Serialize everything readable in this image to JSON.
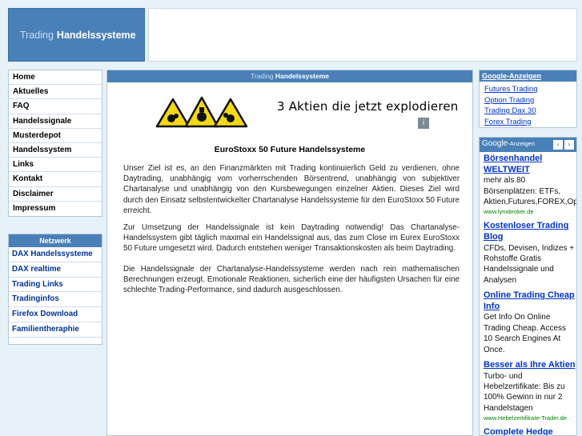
{
  "header": {
    "logo_light": "Trading",
    "logo_bold": "Handelssysteme"
  },
  "nav": [
    "Home",
    "Aktuelles",
    "FAQ",
    "Handelssignale",
    "Musterdepot",
    "Handelssystem",
    "Links",
    "Kontakt",
    "Disclaimer",
    "Impressum"
  ],
  "netzwerk": {
    "title": "Netzwerk",
    "links": [
      "DAX Handelssysteme",
      "DAX realtime",
      "Trading Links",
      "Tradinginfos",
      "Firefox Download",
      "Familientheraphie"
    ]
  },
  "main": {
    "header_light": "Trading",
    "header_bold": "Handelssysteme",
    "banner_text": "3 Aktien die jetzt explodieren",
    "headline": "EuroStoxx 50 Future Handelssysteme",
    "paragraphs": [
      "Unser Ziel ist es, an den Finanzmärkten mit Trading kontinuierlich Geld zu verdienen, ohne Daytrading, unabhängig vom vorherrschenden Börsentrend, unabhängig von subjektiver Chartanalyse und unabhängig von den Kursbewegungen einzelner Aktien. Dieses Ziel wird durch den Einsatz selbstentwickelter Chartanalyse Handelssysteme für den EuroStoxx 50 Future erreicht.",
      "Zur Umsetzung der Handelssignale ist kein Daytrading notwendig! Das Chartanalyse-Handelssystem gibt täglich maximal ein Handelssignal aus, das zum Close im Eurex EuroStoxx 50 Future umgesetzt wird. Dadurch entstehen weniger Transaktionskosten als beim Daytrading.",
      "Die Handelssignale der Chartanalyse-Handelssysteme werden nach rein mathematischen Berechnungen erzeugt. Emotionale Reaktionen, sicherlich eine der häufigsten Ursachen für eine schlechte Trading-Performance, sind dadurch ausgeschlossen."
    ]
  },
  "google_ads": {
    "title": "Google-Anzeigen",
    "links": [
      "Futures Trading",
      "Option Trading",
      "Trading Dax 30",
      "Forex Trading"
    ]
  },
  "ads_box": {
    "google_label": "Google",
    "anzeigen_label": "-Anzeigen",
    "prev_icon": "‹",
    "next_icon": "›",
    "ads": [
      {
        "title_lines": [
          "Börsenhandel",
          "WELTWEIT"
        ],
        "body_lines": [
          "mehr als 80",
          "Börsenplätzen: ETFs,",
          "Aktien,Futures,FOREX,Op"
        ],
        "url": "www.lynxbroker.de"
      },
      {
        "title_lines": [
          "Kostenloser Trading",
          "Blog"
        ],
        "body_lines": [
          "CFDs, Devisen, Indizes +",
          "Rohstoffe Gratis",
          "Handelssignale und",
          "Analysen"
        ],
        "url": ""
      },
      {
        "title_lines": [
          "Online Trading Cheap",
          "Info"
        ],
        "body_lines": [
          "Get Info On Online",
          "Trading Cheap. Access",
          "10 Search Engines At",
          "Once."
        ],
        "url": ""
      },
      {
        "title_lines": [
          "Besser als Ihre Aktien"
        ],
        "body_lines": [
          "Turbo- und",
          "Hebelzertifikate: Bis zu",
          "100% Gewinn in nur 2",
          "Handelstagen"
        ],
        "url": "www.Hebelzertifikate-Trader.de"
      },
      {
        "title_lines": [
          "Complete Hedge"
        ],
        "body_lines": [],
        "url": ""
      }
    ]
  },
  "colors": {
    "page_bg": "#e6f1f8",
    "accent": "#4a80b8",
    "link": "#0033cc",
    "url_green": "#008000"
  }
}
